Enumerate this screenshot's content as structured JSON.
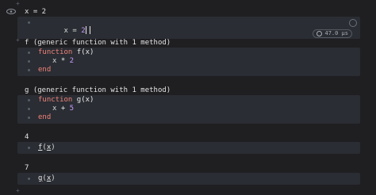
{
  "cells": [
    {
      "output": "x = 2",
      "code": {
        "prefix": "x = ",
        "value": "2"
      },
      "runtime": "47.0 μs"
    },
    {
      "output": "f (generic function with 1 method)",
      "code": {
        "line1_kw": "function",
        "line1_fn": " f(x)",
        "line2_pre": "x ",
        "line2_op": "*",
        "line2_num": " 2",
        "line3_kw": "end"
      }
    },
    {
      "output": "g (generic function with 1 method)",
      "code": {
        "line1_kw": "function",
        "line1_fn": " g(x)",
        "line2_pre": "x ",
        "line2_op": "+",
        "line2_num": " 5",
        "line3_kw": "end"
      }
    },
    {
      "output": "4",
      "code": {
        "call_name": "f",
        "call_open": "(",
        "call_arg": "x",
        "call_close": ")"
      }
    },
    {
      "output": "7",
      "code": {
        "call_name": "g",
        "call_open": "(",
        "call_arg": "x",
        "call_close": ")"
      }
    }
  ],
  "icons": {
    "eye": "eye-icon",
    "clock": "clock-icon",
    "add": "add-cell-icon"
  },
  "colors": {
    "background": "#1f1f22",
    "code_bg": "#2a2d33",
    "keyword": "#f0837a",
    "number": "#c79bff"
  }
}
